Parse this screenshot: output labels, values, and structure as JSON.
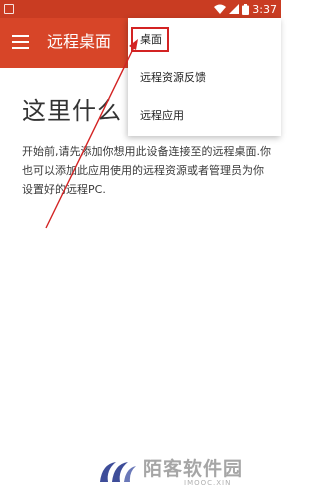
{
  "status_bar": {
    "time": "3:37",
    "icons": [
      "wifi-icon",
      "signal-icon",
      "battery-icon"
    ]
  },
  "app_bar": {
    "menu_icon": "hamburger-menu-icon",
    "title": "远程桌面"
  },
  "empty_state": {
    "title": "这里什么",
    "description": "开始前,请先添加你想用此设备连接至的远程桌面.你也可以添加此应用使用的远程资源或者管理员为你设置好的远程PC."
  },
  "dropdown_menu": {
    "items": [
      {
        "label": "桌面"
      },
      {
        "label": "远程资源反馈"
      },
      {
        "label": "远程应用"
      }
    ]
  },
  "watermark": {
    "name": "陌客软件园",
    "sub": "IMOOC.XIN"
  },
  "colors": {
    "status_bar": "#c93c22",
    "app_bar": "#d74528",
    "highlight": "#d32323"
  }
}
